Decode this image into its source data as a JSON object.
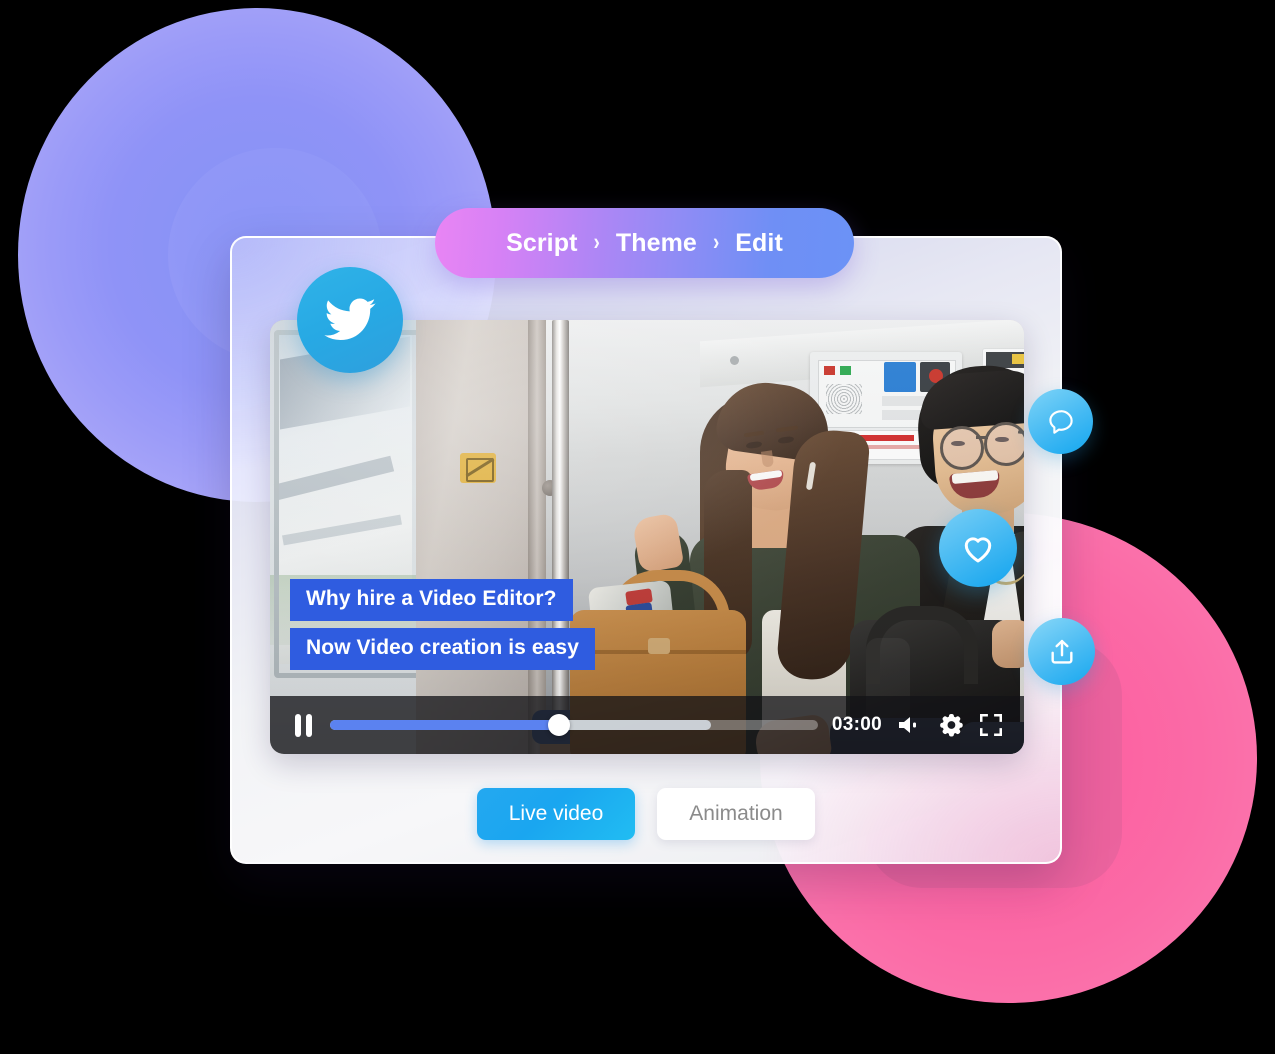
{
  "breadcrumb": {
    "steps": [
      {
        "label": "Script",
        "name": "script"
      },
      {
        "label": "Theme",
        "name": "theme"
      },
      {
        "label": "Edit",
        "name": "edit"
      }
    ],
    "separator": "›"
  },
  "video": {
    "captions": [
      "Why hire a Video Editor?",
      "Now Video creation is easy"
    ],
    "scene_description": "Two young people smiling and laughing while sitting on a train; a tan leather handbag and a black backpack in the foreground.",
    "controls": {
      "play_state": "paused",
      "play_pause_label": "Pause",
      "time": "03:00",
      "progress_percent": 47,
      "buffered_percent": 78,
      "volume_label": "Volume",
      "settings_label": "Settings",
      "fullscreen_label": "Fullscreen"
    }
  },
  "modes": {
    "options": [
      {
        "label": "Live video",
        "name": "live-video",
        "selected": true
      },
      {
        "label": "Animation",
        "name": "animation",
        "selected": false
      }
    ]
  },
  "bubbles": [
    {
      "name": "twitter",
      "icon": "twitter-icon",
      "label": "Share on Twitter"
    },
    {
      "name": "comment",
      "icon": "comment-icon",
      "label": "Comment"
    },
    {
      "name": "like",
      "icon": "heart-icon",
      "label": "Like"
    },
    {
      "name": "share",
      "icon": "upload-icon",
      "label": "Share"
    }
  ],
  "colors": {
    "pill_gradient_start": "#e985f4",
    "pill_gradient_end": "#6b92f6",
    "caption_background": "#2f5ce0",
    "live_video_button": "#1aa6f0",
    "progress_fill": "#5b82f0",
    "bubble_blue": "#27a9e4",
    "blob_purple": "#8b93f6",
    "blob_pink": "#fb63a2"
  }
}
